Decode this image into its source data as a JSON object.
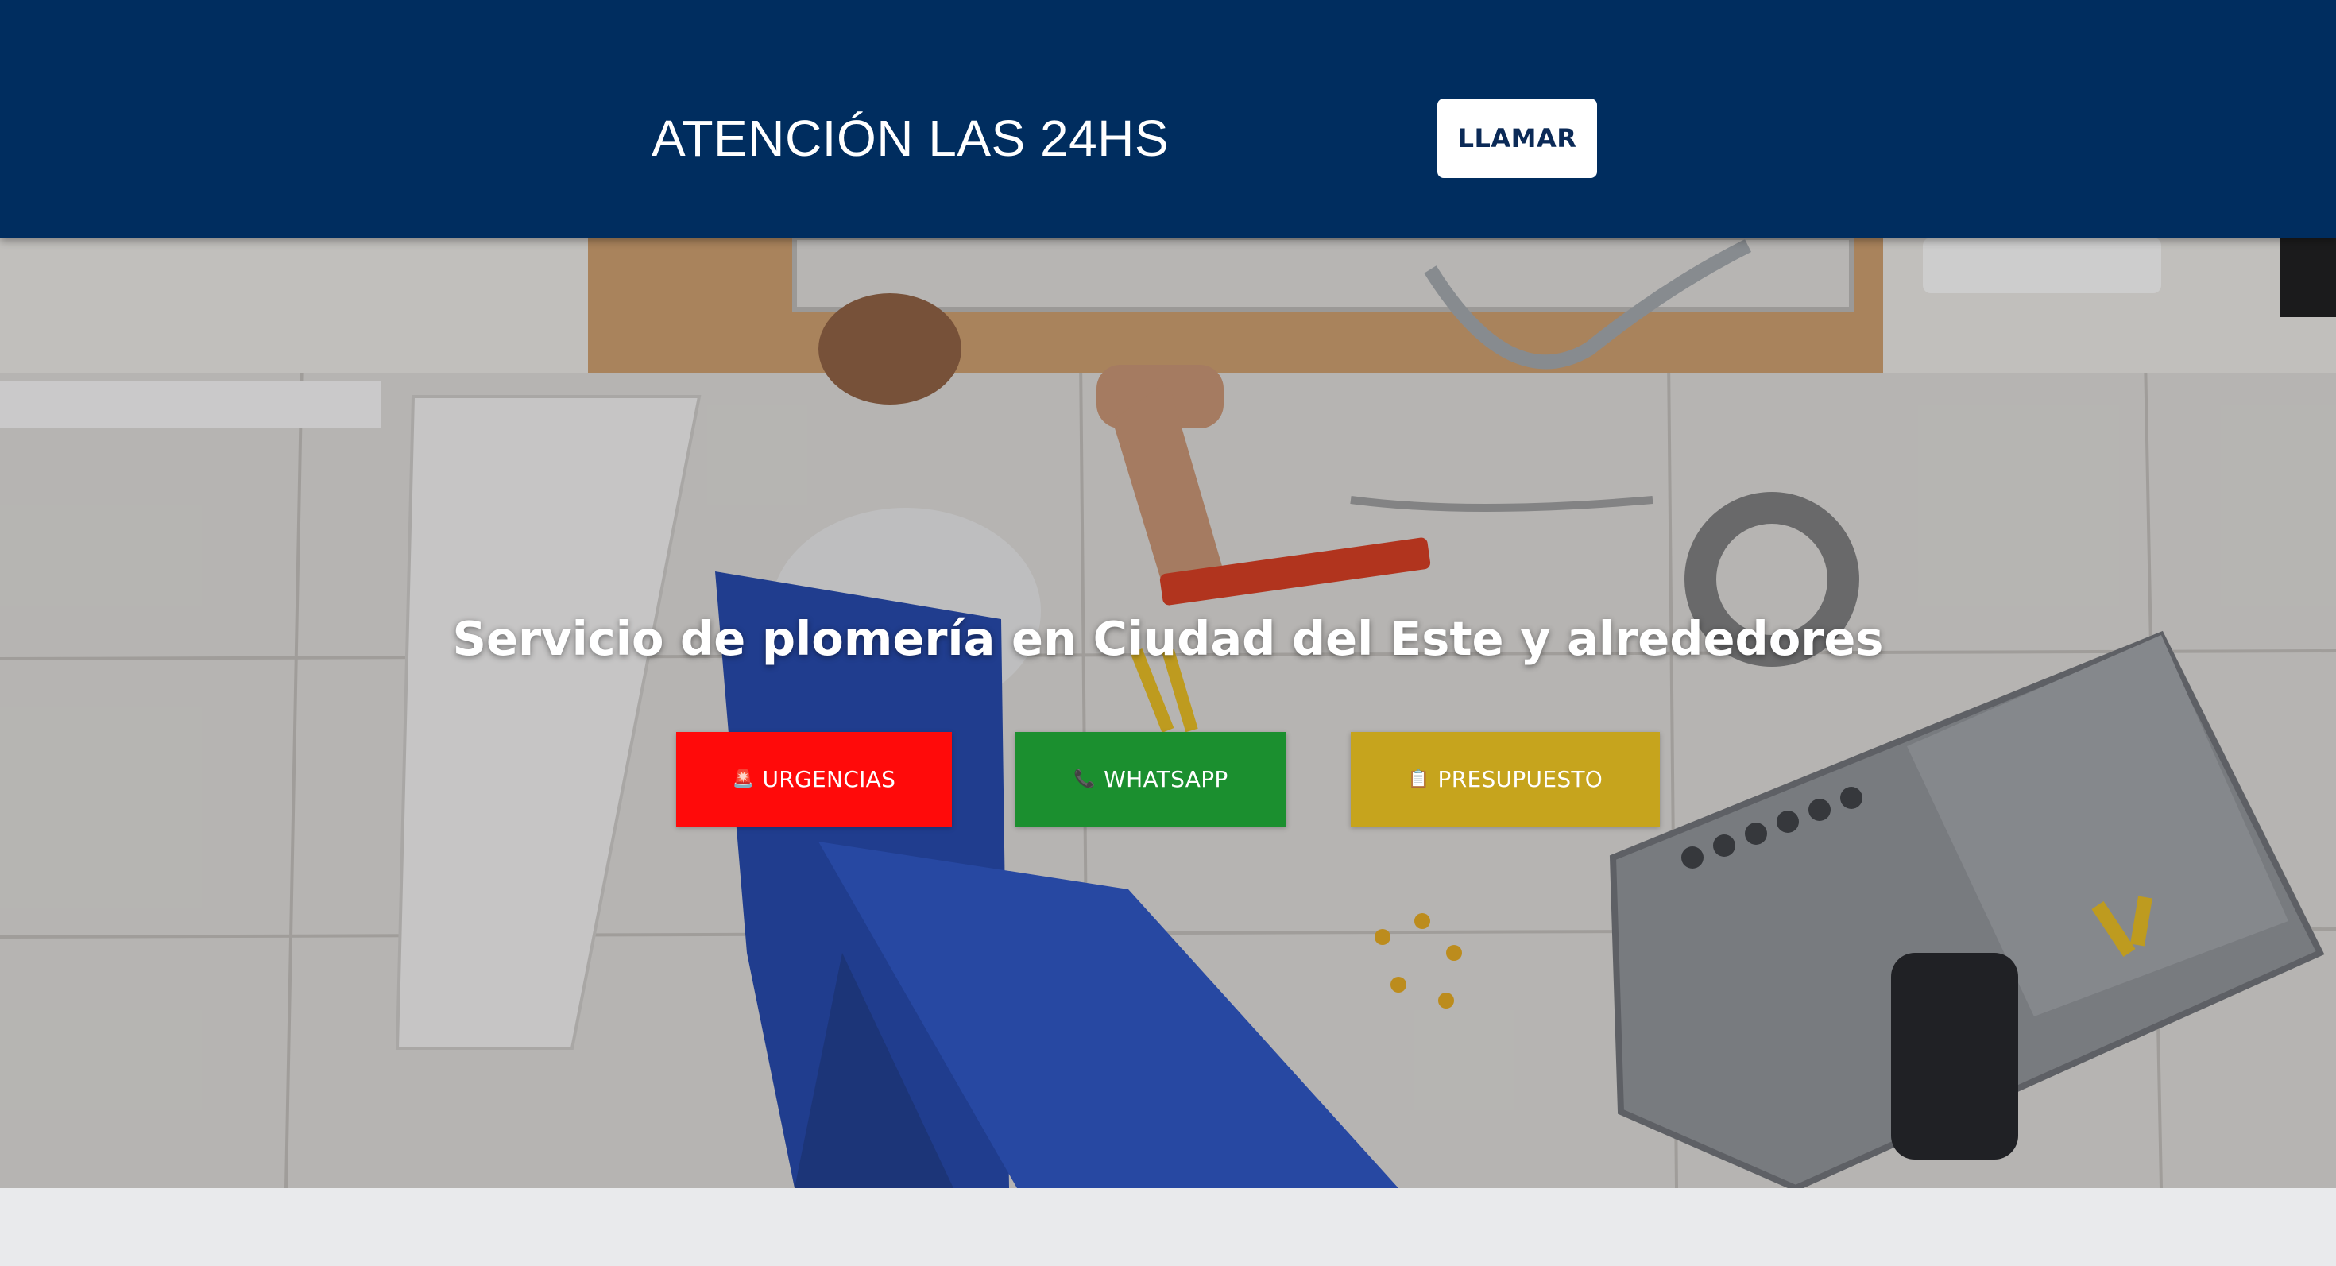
{
  "header": {
    "title": "ATENCIÓN LAS 24HS",
    "call_label": "LLAMAR"
  },
  "hero": {
    "heading": "Servicio de plomería en Ciudad del Este y alrededores",
    "buttons": [
      {
        "icon": "🚨",
        "label": "URGENCIAS",
        "color": "#ff0a0a"
      },
      {
        "icon": "📞",
        "label": "WHATSAPP",
        "color": "#1b8f2f"
      },
      {
        "icon": "📋",
        "label": "PRESUPUESTO",
        "color": "#c6a41d"
      }
    ]
  },
  "colors": {
    "header_bg": "#002d5f",
    "page_bg": "#e9eaec",
    "call_text": "#0b2a57"
  }
}
